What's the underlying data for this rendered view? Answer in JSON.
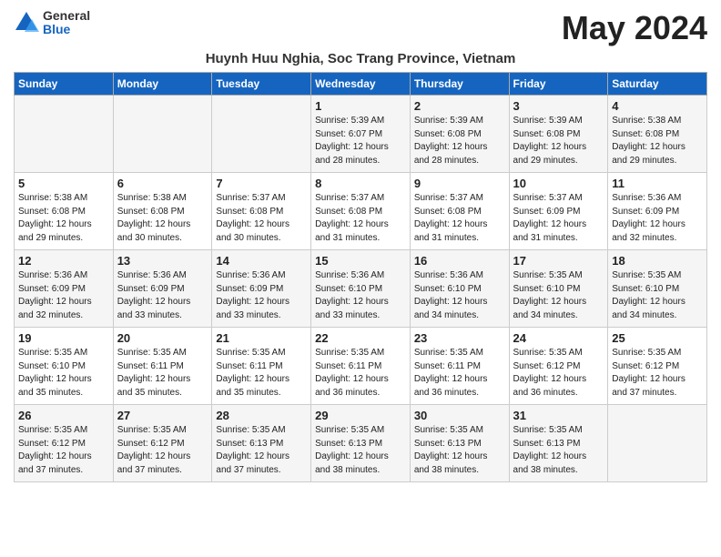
{
  "logo": {
    "general": "General",
    "blue": "Blue"
  },
  "title": "May 2024",
  "subtitle": "Huynh Huu Nghia, Soc Trang Province, Vietnam",
  "days_header": [
    "Sunday",
    "Monday",
    "Tuesday",
    "Wednesday",
    "Thursday",
    "Friday",
    "Saturday"
  ],
  "weeks": [
    [
      {
        "num": "",
        "info": ""
      },
      {
        "num": "",
        "info": ""
      },
      {
        "num": "",
        "info": ""
      },
      {
        "num": "1",
        "info": "Sunrise: 5:39 AM\nSunset: 6:07 PM\nDaylight: 12 hours\nand 28 minutes."
      },
      {
        "num": "2",
        "info": "Sunrise: 5:39 AM\nSunset: 6:08 PM\nDaylight: 12 hours\nand 28 minutes."
      },
      {
        "num": "3",
        "info": "Sunrise: 5:39 AM\nSunset: 6:08 PM\nDaylight: 12 hours\nand 29 minutes."
      },
      {
        "num": "4",
        "info": "Sunrise: 5:38 AM\nSunset: 6:08 PM\nDaylight: 12 hours\nand 29 minutes."
      }
    ],
    [
      {
        "num": "5",
        "info": "Sunrise: 5:38 AM\nSunset: 6:08 PM\nDaylight: 12 hours\nand 29 minutes."
      },
      {
        "num": "6",
        "info": "Sunrise: 5:38 AM\nSunset: 6:08 PM\nDaylight: 12 hours\nand 30 minutes."
      },
      {
        "num": "7",
        "info": "Sunrise: 5:37 AM\nSunset: 6:08 PM\nDaylight: 12 hours\nand 30 minutes."
      },
      {
        "num": "8",
        "info": "Sunrise: 5:37 AM\nSunset: 6:08 PM\nDaylight: 12 hours\nand 31 minutes."
      },
      {
        "num": "9",
        "info": "Sunrise: 5:37 AM\nSunset: 6:08 PM\nDaylight: 12 hours\nand 31 minutes."
      },
      {
        "num": "10",
        "info": "Sunrise: 5:37 AM\nSunset: 6:09 PM\nDaylight: 12 hours\nand 31 minutes."
      },
      {
        "num": "11",
        "info": "Sunrise: 5:36 AM\nSunset: 6:09 PM\nDaylight: 12 hours\nand 32 minutes."
      }
    ],
    [
      {
        "num": "12",
        "info": "Sunrise: 5:36 AM\nSunset: 6:09 PM\nDaylight: 12 hours\nand 32 minutes."
      },
      {
        "num": "13",
        "info": "Sunrise: 5:36 AM\nSunset: 6:09 PM\nDaylight: 12 hours\nand 33 minutes."
      },
      {
        "num": "14",
        "info": "Sunrise: 5:36 AM\nSunset: 6:09 PM\nDaylight: 12 hours\nand 33 minutes."
      },
      {
        "num": "15",
        "info": "Sunrise: 5:36 AM\nSunset: 6:10 PM\nDaylight: 12 hours\nand 33 minutes."
      },
      {
        "num": "16",
        "info": "Sunrise: 5:36 AM\nSunset: 6:10 PM\nDaylight: 12 hours\nand 34 minutes."
      },
      {
        "num": "17",
        "info": "Sunrise: 5:35 AM\nSunset: 6:10 PM\nDaylight: 12 hours\nand 34 minutes."
      },
      {
        "num": "18",
        "info": "Sunrise: 5:35 AM\nSunset: 6:10 PM\nDaylight: 12 hours\nand 34 minutes."
      }
    ],
    [
      {
        "num": "19",
        "info": "Sunrise: 5:35 AM\nSunset: 6:10 PM\nDaylight: 12 hours\nand 35 minutes."
      },
      {
        "num": "20",
        "info": "Sunrise: 5:35 AM\nSunset: 6:11 PM\nDaylight: 12 hours\nand 35 minutes."
      },
      {
        "num": "21",
        "info": "Sunrise: 5:35 AM\nSunset: 6:11 PM\nDaylight: 12 hours\nand 35 minutes."
      },
      {
        "num": "22",
        "info": "Sunrise: 5:35 AM\nSunset: 6:11 PM\nDaylight: 12 hours\nand 36 minutes."
      },
      {
        "num": "23",
        "info": "Sunrise: 5:35 AM\nSunset: 6:11 PM\nDaylight: 12 hours\nand 36 minutes."
      },
      {
        "num": "24",
        "info": "Sunrise: 5:35 AM\nSunset: 6:12 PM\nDaylight: 12 hours\nand 36 minutes."
      },
      {
        "num": "25",
        "info": "Sunrise: 5:35 AM\nSunset: 6:12 PM\nDaylight: 12 hours\nand 37 minutes."
      }
    ],
    [
      {
        "num": "26",
        "info": "Sunrise: 5:35 AM\nSunset: 6:12 PM\nDaylight: 12 hours\nand 37 minutes."
      },
      {
        "num": "27",
        "info": "Sunrise: 5:35 AM\nSunset: 6:12 PM\nDaylight: 12 hours\nand 37 minutes."
      },
      {
        "num": "28",
        "info": "Sunrise: 5:35 AM\nSunset: 6:13 PM\nDaylight: 12 hours\nand 37 minutes."
      },
      {
        "num": "29",
        "info": "Sunrise: 5:35 AM\nSunset: 6:13 PM\nDaylight: 12 hours\nand 38 minutes."
      },
      {
        "num": "30",
        "info": "Sunrise: 5:35 AM\nSunset: 6:13 PM\nDaylight: 12 hours\nand 38 minutes."
      },
      {
        "num": "31",
        "info": "Sunrise: 5:35 AM\nSunset: 6:13 PM\nDaylight: 12 hours\nand 38 minutes."
      },
      {
        "num": "",
        "info": ""
      }
    ]
  ]
}
